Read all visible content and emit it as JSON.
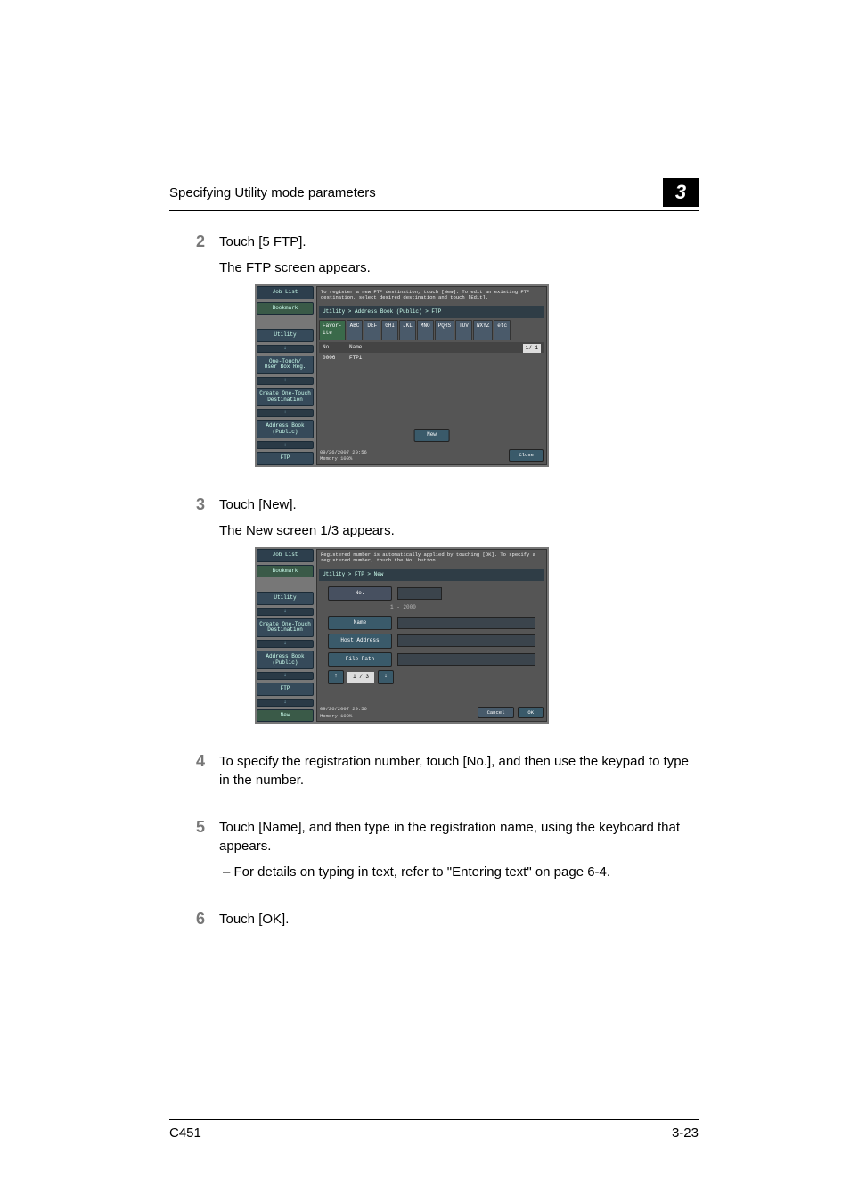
{
  "header": {
    "section_title": "Specifying Utility mode parameters",
    "chapter_number": "3"
  },
  "steps": {
    "s2": {
      "num": "2",
      "line1": "Touch [5 FTP].",
      "line2": "The FTP screen appears."
    },
    "s3": {
      "num": "3",
      "line1": "Touch [New].",
      "line2": "The New screen 1/3 appears."
    },
    "s4": {
      "num": "4",
      "line1": "To specify the registration number, touch [No.], and then use the keypad to type in the number."
    },
    "s5": {
      "num": "5",
      "line1": "Touch [Name], and then type in the registration name, using the keyboard that appears.",
      "sub1": "– For details on typing in text, refer to \"Entering text\" on page 6-4."
    },
    "s6": {
      "num": "6",
      "line1": "Touch [OK]."
    }
  },
  "panel1": {
    "instr": "To register a new FTP destination, touch [New]. To edit an existing FTP destination, select desired destination and touch [Edit].",
    "breadcrumb": "Utility > Address Book (Public) > FTP",
    "sidebar": {
      "job_list": "Job List",
      "bookmark": "Bookmark",
      "utility": "Utility",
      "one_touch": "One-Touch/\nUser Box Reg.",
      "create": "Create One-Touch\nDestination",
      "address": "Address Book\n(Public)",
      "ftp": "FTP"
    },
    "tabs": [
      "Favor-\nite",
      "ABC",
      "DEF",
      "GHI",
      "JKL",
      "MNO",
      "PQRS",
      "TUV",
      "WXYZ",
      "etc"
    ],
    "list": {
      "header_no": "No",
      "header_name": "Name",
      "row1_no": "0006",
      "row1_name": "FTP1",
      "page": "1/ 1"
    },
    "new_btn": "New",
    "footer": {
      "date": "09/26/2007 20:56",
      "memory": "Memory        100%",
      "close": "Close"
    }
  },
  "panel2": {
    "instr": "Registered number is automatically applied by touching [OK]. To specify a registered number, touch the No. button.",
    "breadcrumb": "Utility > FTP > New",
    "sidebar": {
      "job_list": "Job List",
      "bookmark": "Bookmark",
      "utility": "Utility",
      "create": "Create One-Touch\nDestination",
      "address": "Address Book\n(Public)",
      "ftp": "FTP",
      "new": "New"
    },
    "fields": {
      "no_label": "No.",
      "no_value": "----",
      "range": "1 - 2000",
      "name_label": "Name",
      "host_label": "Host Address",
      "path_label": "File Path"
    },
    "pager": "1 / 3",
    "footer": {
      "date": "09/26/2007 20:56",
      "memory": "Memory        100%",
      "cancel": "Cancel",
      "ok": "OK"
    }
  },
  "page_footer": {
    "model": "C451",
    "page": "3-23"
  }
}
